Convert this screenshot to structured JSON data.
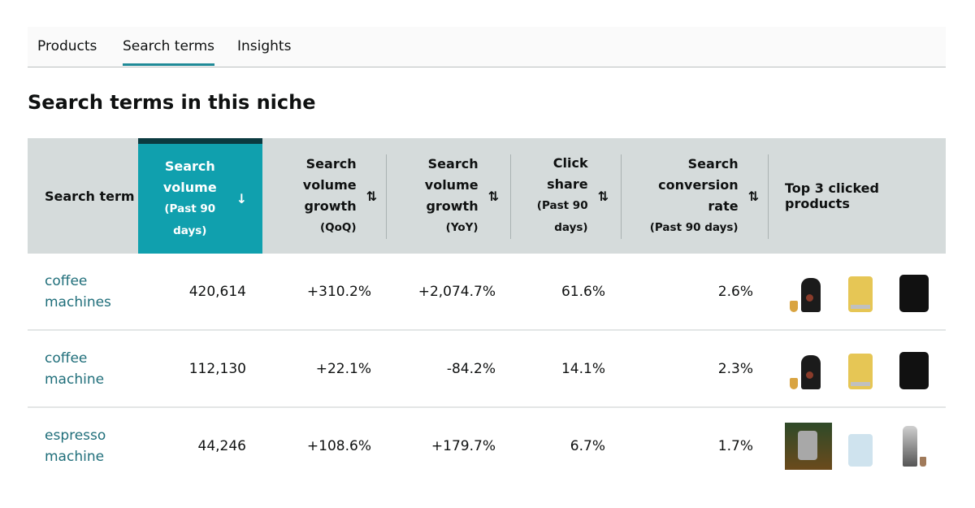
{
  "tabs": [
    {
      "label": "Products",
      "active": false
    },
    {
      "label": "Search terms",
      "active": true
    },
    {
      "label": "Insights",
      "active": false
    }
  ],
  "section_title": "Search terms in this niche",
  "colors": {
    "accent": "#10a0ae",
    "header_bg": "#d5dbdb",
    "link": "#1f6e7a"
  },
  "columns": [
    {
      "label": "Search term",
      "sub": "",
      "sort_icon": ""
    },
    {
      "label": "Search volume",
      "sub": "(Past 90 days)",
      "sort_icon": "↓"
    },
    {
      "label": "Search volume growth",
      "sub": "(QoQ)",
      "sort_icon": "⇅"
    },
    {
      "label": "Search volume growth",
      "sub": "(YoY)",
      "sort_icon": "⇅"
    },
    {
      "label": "Click share",
      "sub": "(Past 90 days)",
      "sort_icon": "⇅"
    },
    {
      "label": "Search conversion rate",
      "sub": "(Past 90 days)",
      "sort_icon": "⇅"
    },
    {
      "label": "Top 3 clicked products",
      "sub": "",
      "sort_icon": ""
    }
  ],
  "rows": [
    {
      "term": "coffee machines",
      "volume": "420,614",
      "qoq": "+310.2%",
      "yoy": "+2,074.7%",
      "click_share": "61.6%",
      "conversion": "2.6%",
      "products": [
        "black-capsule-coffee-machine",
        "yellow-espresso-machine",
        "black-pod-coffee-machine"
      ]
    },
    {
      "term": "coffee machine",
      "volume": "112,130",
      "qoq": "+22.1%",
      "yoy": "-84.2%",
      "click_share": "14.1%",
      "conversion": "2.3%",
      "products": [
        "black-capsule-coffee-machine",
        "yellow-espresso-machine",
        "black-pod-coffee-machine"
      ]
    },
    {
      "term": "espresso machine",
      "volume": "44,246",
      "qoq": "+108.6%",
      "yoy": "+179.7%",
      "click_share": "6.7%",
      "conversion": "1.7%",
      "products": [
        "espresso-machine-lifestyle-photo",
        "light-blue-espresso-machine",
        "silver-espresso-machine"
      ]
    }
  ]
}
